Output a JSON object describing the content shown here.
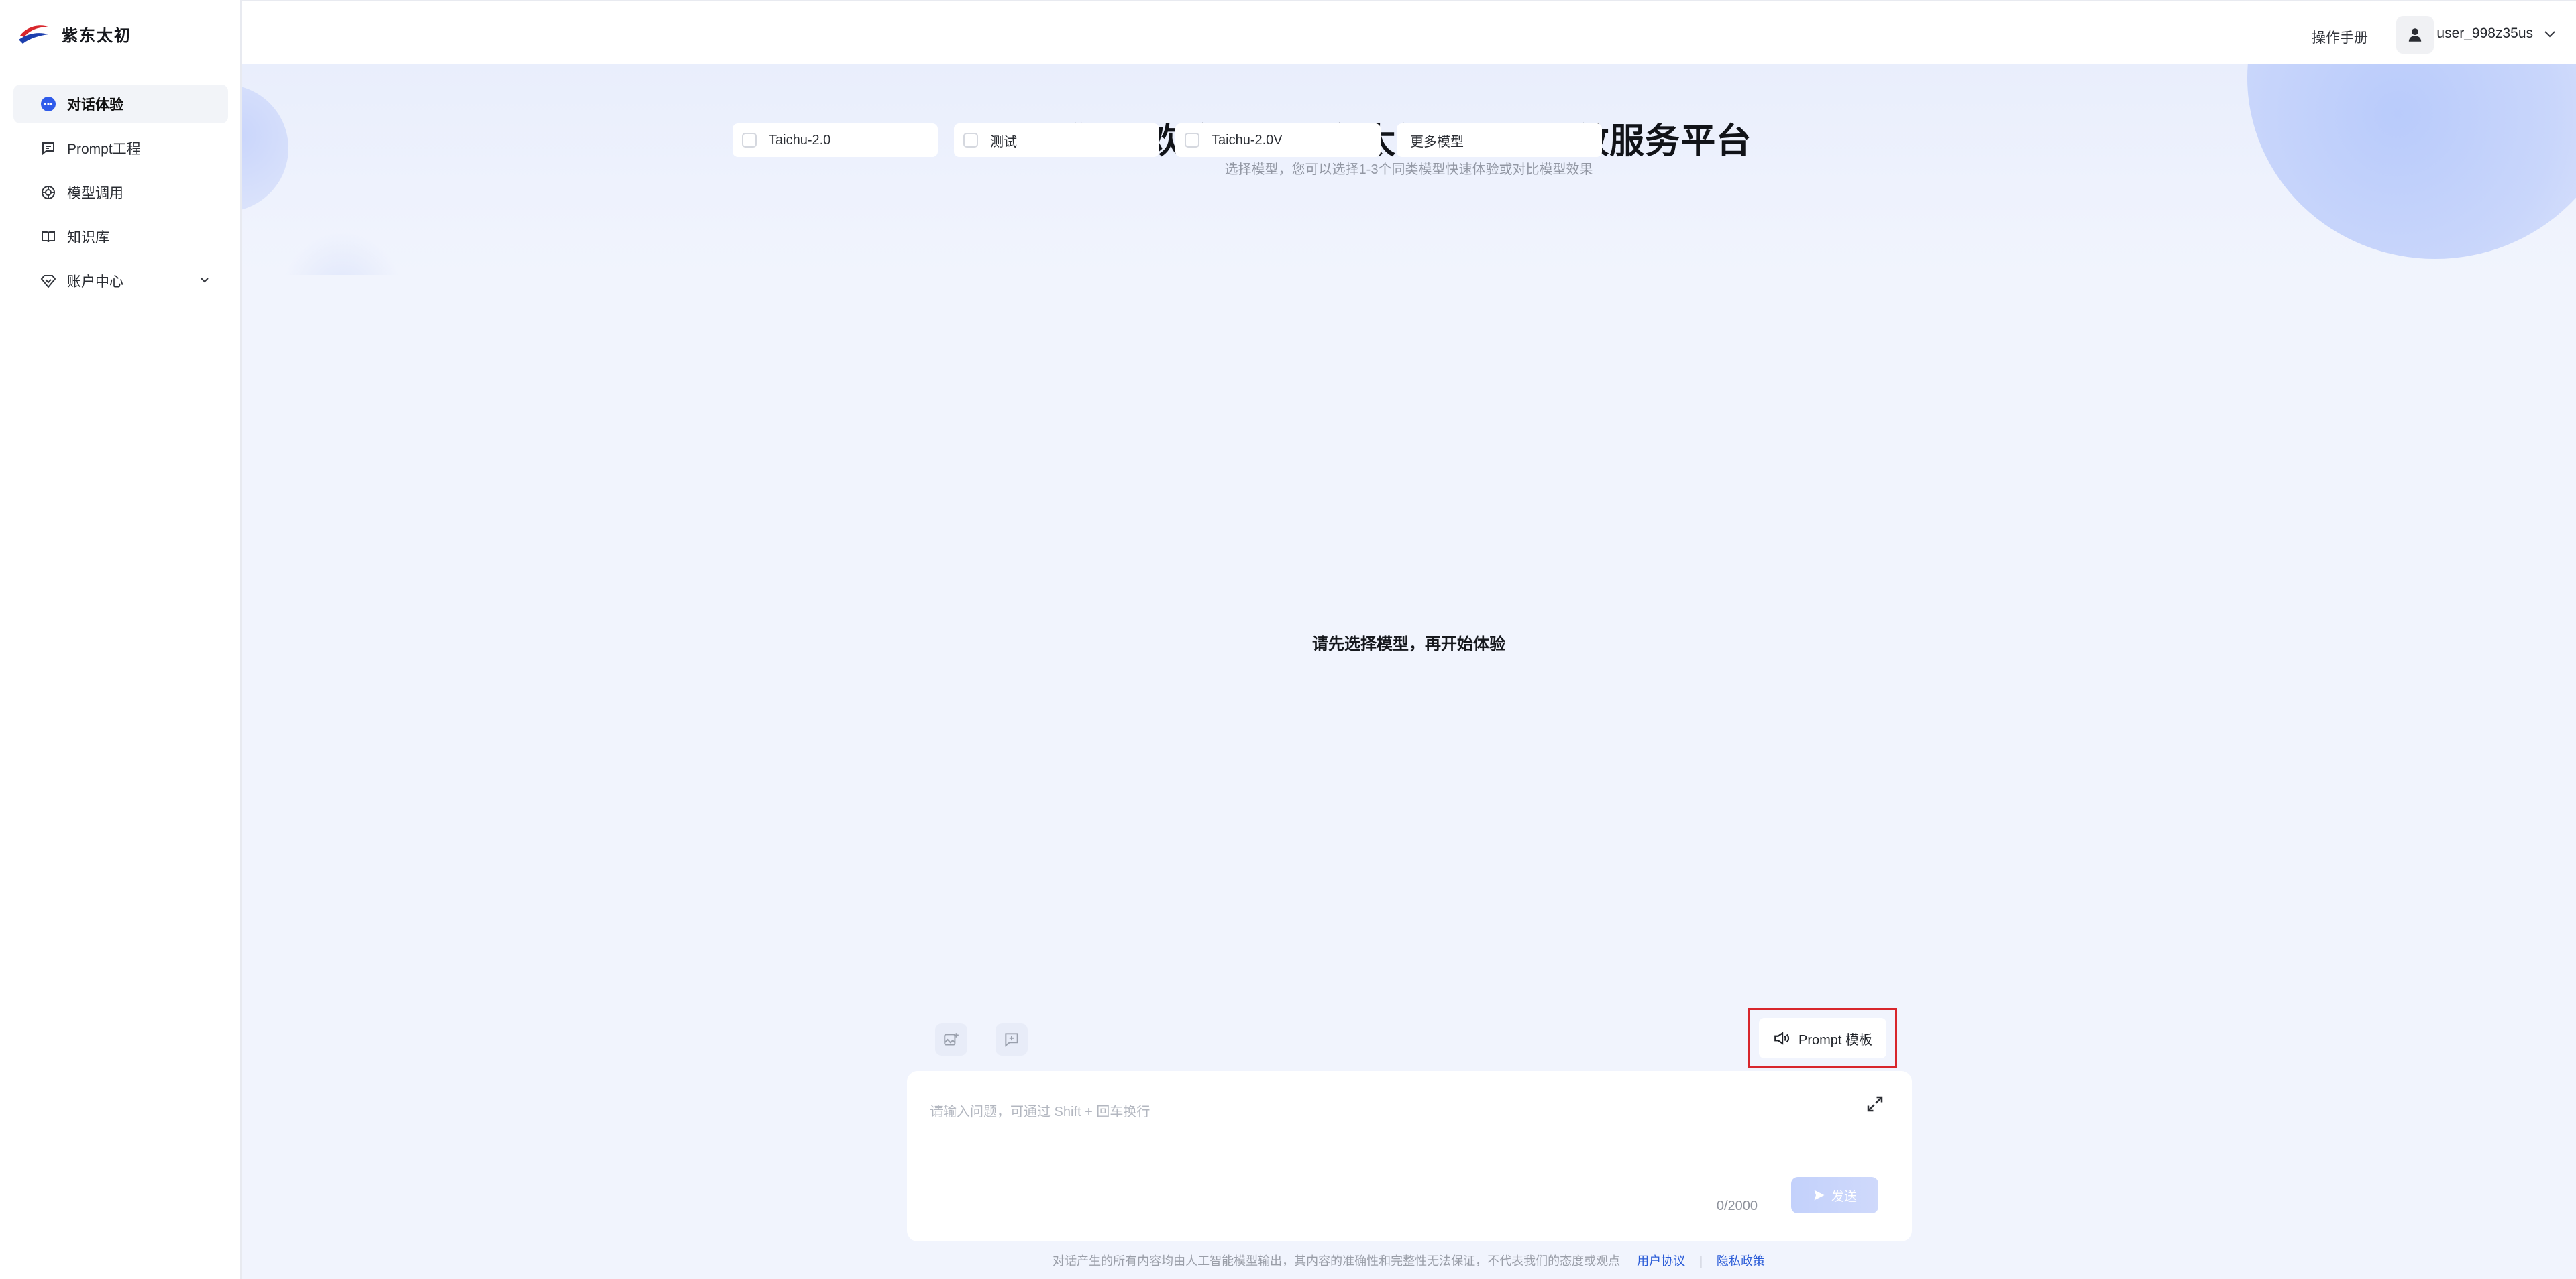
{
  "brand": {
    "name": "紫东太初",
    "colors": {
      "red": "#d8262c",
      "blue": "#1d3fae"
    }
  },
  "sidebar": {
    "items": [
      {
        "label": "对话体验",
        "icon": "chat-bubble-icon",
        "active": true
      },
      {
        "label": "Prompt工程",
        "icon": "prompt-doc-icon",
        "active": false
      },
      {
        "label": "模型调用",
        "icon": "model-api-icon",
        "active": false
      },
      {
        "label": "知识库",
        "icon": "book-icon",
        "active": false
      },
      {
        "label": "账户中心",
        "icon": "account-diamond-icon",
        "active": false,
        "expandable": true
      }
    ]
  },
  "topbar": {
    "manual": "操作手册",
    "username": "user_998z35us"
  },
  "hero": {
    "title": "您好 欢迎使用紫东太初大模型开放服务平台",
    "subtitle": "选择模型，您可以选择1-3个同类模型快速体验或对比模型效果",
    "models": [
      {
        "label": "Taichu-2.0",
        "checked": false
      },
      {
        "label": "测试",
        "checked": false
      },
      {
        "label": "Taichu-2.0V",
        "checked": false
      }
    ],
    "more_models": "更多模型"
  },
  "main": {
    "empty_message": "请先选择模型，再开始体验"
  },
  "composer": {
    "prompt_template": "Prompt 模板",
    "placeholder": "请输入问题，可通过 Shift + 回车换行",
    "counter": "0/2000",
    "send": "发送"
  },
  "footer": {
    "disclaimer": "对话产生的所有内容均由人工智能模型输出，其内容的准确性和完整性无法保证，不代表我们的态度或观点",
    "user_agreement": "用户协议",
    "separator": "|",
    "privacy": "隐私政策"
  }
}
